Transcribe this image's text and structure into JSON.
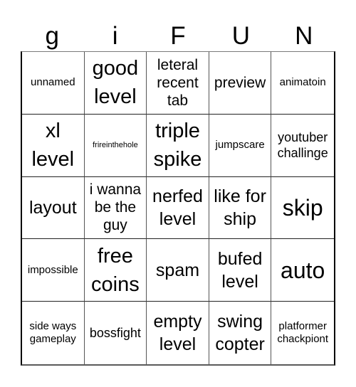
{
  "header": {
    "letters": [
      "g",
      "i",
      "F",
      "U",
      "N"
    ]
  },
  "board": {
    "cells": [
      {
        "text": "unnamed",
        "size": "s-sm"
      },
      {
        "text": "good level",
        "size": "s-xl"
      },
      {
        "text": "leteral recent tab",
        "size": "s-md2"
      },
      {
        "text": "preview",
        "size": "s-md2"
      },
      {
        "text": "animatoin",
        "size": "s-sm"
      },
      {
        "text": "xl level",
        "size": "s-xl"
      },
      {
        "text": "frireinthehole",
        "size": "s-xs"
      },
      {
        "text": "triple spike",
        "size": "s-xl"
      },
      {
        "text": "jumpscare",
        "size": "s-sm"
      },
      {
        "text": "youtuber challinge",
        "size": "s-md"
      },
      {
        "text": "layout",
        "size": "s-lg"
      },
      {
        "text": "i wanna be the guy",
        "size": "s-md2"
      },
      {
        "text": "nerfed level",
        "size": "s-lg"
      },
      {
        "text": "like for ship",
        "size": "s-lg"
      },
      {
        "text": "skip",
        "size": "s-xxl"
      },
      {
        "text": "impossible",
        "size": "s-sm"
      },
      {
        "text": "free coins",
        "size": "s-xl"
      },
      {
        "text": "spam",
        "size": "s-lg"
      },
      {
        "text": "bufed level",
        "size": "s-lg"
      },
      {
        "text": "auto",
        "size": "s-xxl"
      },
      {
        "text": "side ways gameplay",
        "size": "s-sm"
      },
      {
        "text": "bossfight",
        "size": "s-md"
      },
      {
        "text": "empty level",
        "size": "s-lg"
      },
      {
        "text": "swing copter",
        "size": "s-lg"
      },
      {
        "text": "platformer chackpiont",
        "size": "s-sm"
      }
    ]
  }
}
